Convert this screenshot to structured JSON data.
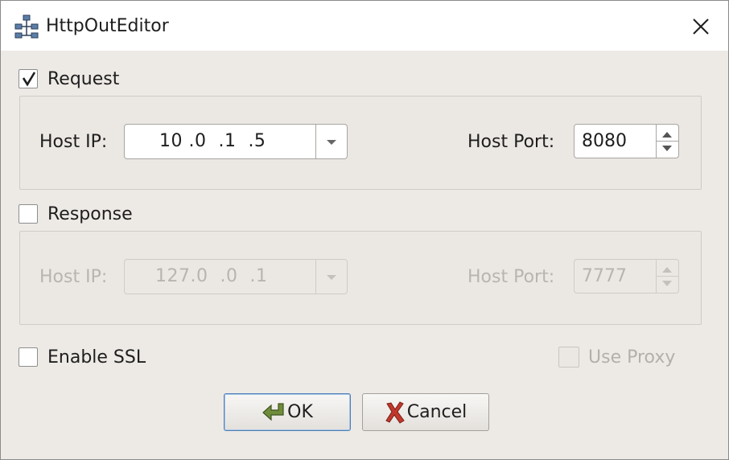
{
  "window": {
    "title": "HttpOutEditor",
    "app_icon": "network-nodes-icon",
    "close_icon": "close-icon"
  },
  "request": {
    "label": "Request",
    "checked": true,
    "host_ip_label": "Host IP:",
    "host_ip_value": "10 .0  .1  .5",
    "host_port_label": "Host Port:",
    "host_port_value": "8080"
  },
  "response": {
    "label": "Response",
    "checked": false,
    "host_ip_label": "Host IP:",
    "host_ip_value": "127.0  .0  .1",
    "host_port_label": "Host Port:",
    "host_port_value": "7777"
  },
  "options": {
    "enable_ssl_label": "Enable SSL",
    "enable_ssl_checked": false,
    "use_proxy_label": "Use Proxy",
    "use_proxy_checked": false
  },
  "buttons": {
    "ok_label": "OK",
    "ok_icon": "ok-arrow-icon",
    "cancel_label": "Cancel",
    "cancel_icon": "cancel-x-icon"
  },
  "colors": {
    "window_bg": "#edeae6",
    "default_button_border": "#4f7fb8",
    "ok_icon_green": "#6e8c3a",
    "cancel_icon_red": "#c0392b"
  }
}
